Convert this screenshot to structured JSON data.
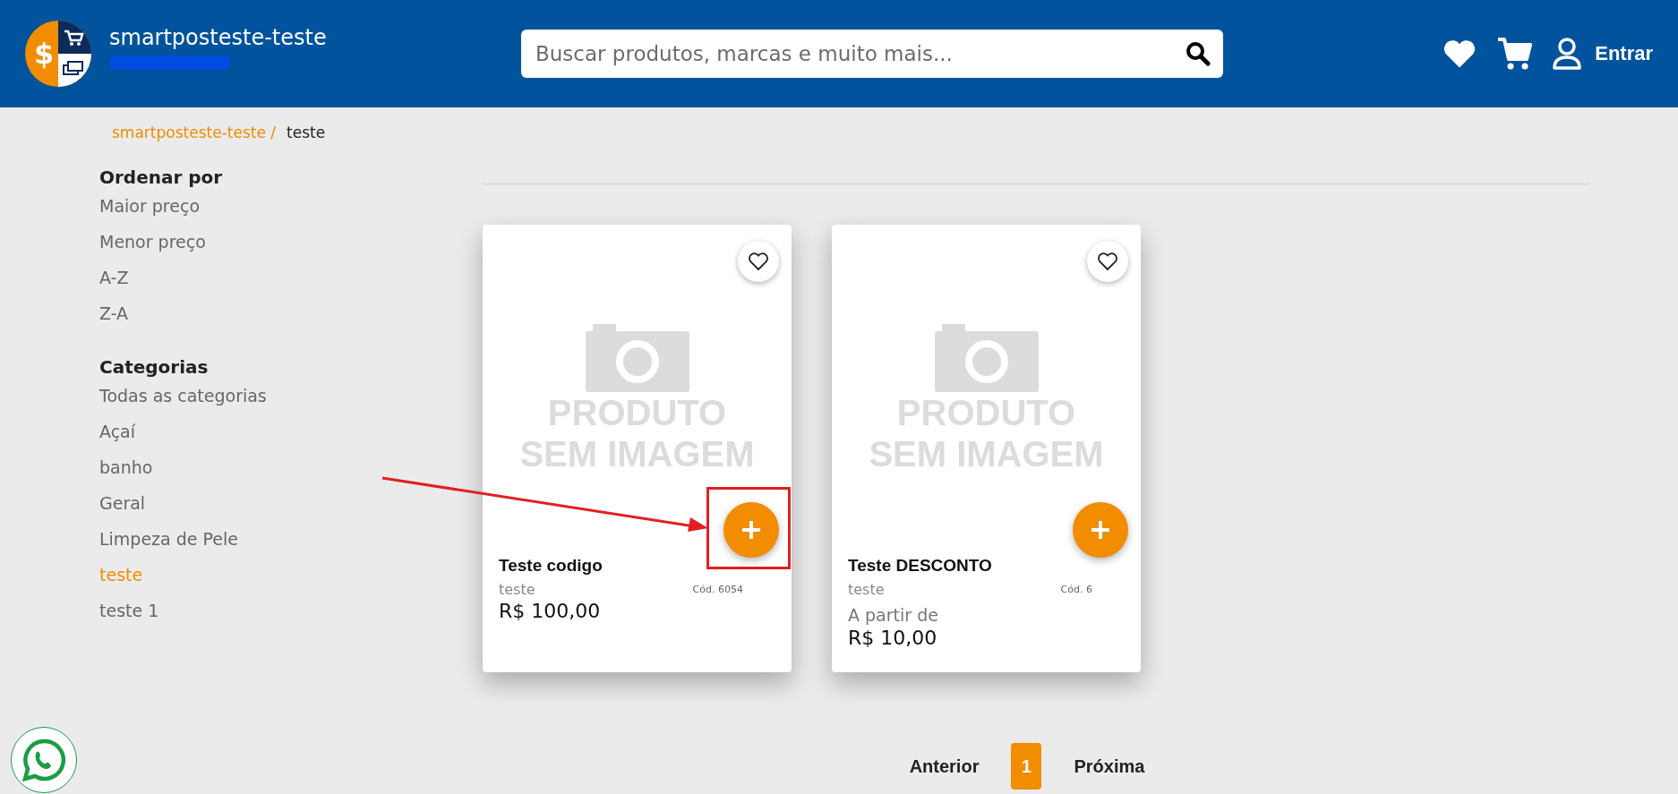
{
  "header": {
    "logo_symbol": "$",
    "store_name": "smartposteste-teste",
    "search": {
      "placeholder": "Buscar produtos, marcas e muito mais..."
    },
    "login_label": "Entrar"
  },
  "breadcrumb": [
    {
      "label": "smartposteste-teste /",
      "current": false
    },
    {
      "label": "teste",
      "current": true
    }
  ],
  "sort": {
    "title": "Ordenar por",
    "options": [
      "Maior preço",
      "Menor preço",
      "A-Z",
      "Z-A"
    ]
  },
  "categories": {
    "title": "Categorias",
    "items": [
      {
        "label": "Todas as categorias",
        "selected": false
      },
      {
        "label": "Açaí",
        "selected": false
      },
      {
        "label": "banho",
        "selected": false
      },
      {
        "label": "Geral",
        "selected": false
      },
      {
        "label": "Limpeza de Pele",
        "selected": false
      },
      {
        "label": "teste",
        "selected": true
      },
      {
        "label": "teste 1",
        "selected": false
      }
    ]
  },
  "products": [
    {
      "image_text": [
        "PRODUTO",
        "SEM IMAGEM"
      ],
      "name": "Teste codigo",
      "category": "teste",
      "code": "Cód. 6054",
      "price": "R$ 100,00",
      "highlighted": true
    },
    {
      "image_text": [
        "PRODUTO",
        "SEM IMAGEM"
      ],
      "name": "Teste DESCONTO",
      "category": "teste",
      "code": "Cód. 6",
      "price_prefix": "A partir de",
      "price": "R$ 10,00",
      "highlighted": false
    }
  ],
  "pagination": {
    "previous": "Anterior",
    "pages": [
      {
        "label": "1",
        "selected": true
      }
    ],
    "next": "Próxima"
  }
}
